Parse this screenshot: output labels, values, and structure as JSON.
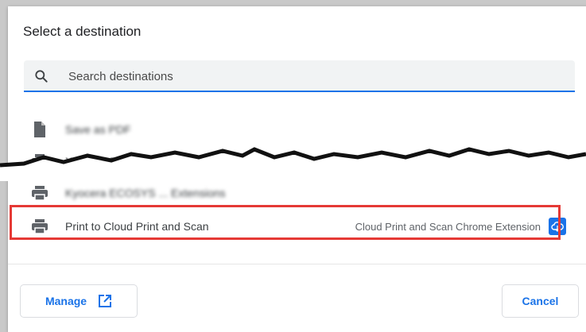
{
  "dialog": {
    "title": "Select a destination",
    "search": {
      "placeholder": "Search destinations",
      "value": ""
    },
    "destinations": [
      {
        "label": "Save as PDF",
        "icon": "file-icon",
        "obscured": true
      },
      {
        "label": "Xerox ... Driver PS",
        "icon": "printer-icon",
        "obscured": true
      },
      {
        "label": "Kyocera ECOSYS ... Extensions",
        "icon": "printer-icon",
        "obscured": true
      },
      {
        "label": "Print to Cloud Print and Scan",
        "icon": "printer-icon",
        "extension": "Cloud Print and Scan Chrome Extension",
        "ext_icon": "cloud-print-icon",
        "highlighted": true
      }
    ],
    "buttons": {
      "manage": "Manage",
      "cancel": "Cancel"
    }
  },
  "colors": {
    "accent": "#1a73e8",
    "highlight": "#e53935"
  }
}
